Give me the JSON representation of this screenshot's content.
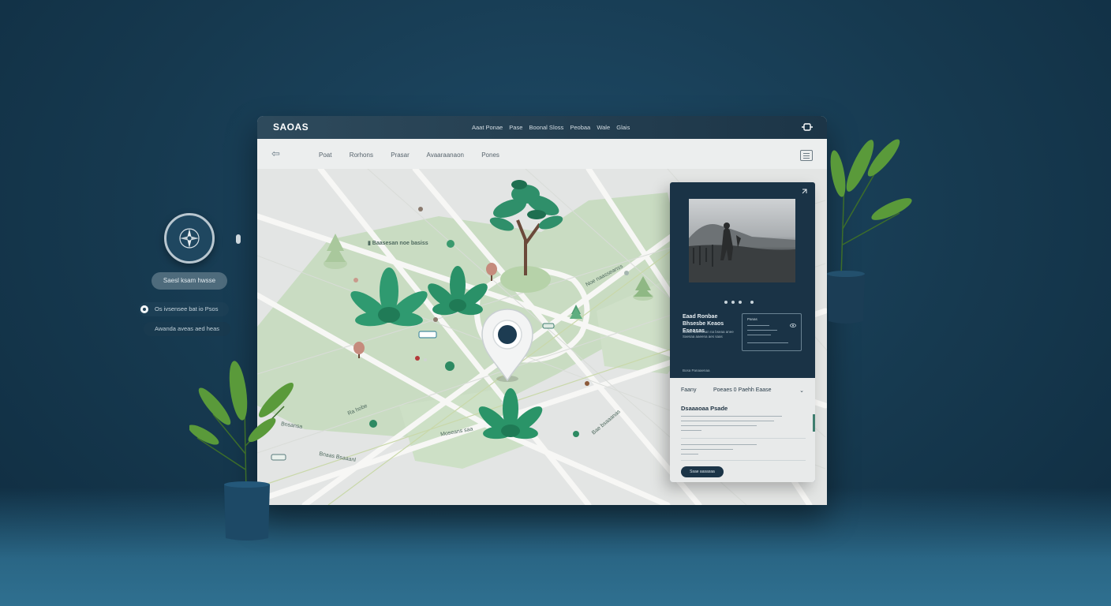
{
  "left_panel": {
    "compass_icon": "compass-icon",
    "primary_pill": "Saesl ksam hwsse",
    "radio_option": "Os ivsensee bat io Psos",
    "secondary_pill": "Awanda aveas aed heas"
  },
  "window": {
    "brand": "SAOAS",
    "top_menu": [
      "Aaat Ponae",
      "Pase",
      "Boonal Sloss",
      "Peobaa",
      "Wale",
      "Glais"
    ],
    "nav_tabs": [
      "Poat",
      "Rorhons",
      "Prasar",
      "Avaaraanaon",
      "Pones"
    ],
    "icons": {
      "window_toggle": "window-toggle-icon",
      "back": "back-arrow-icon",
      "menu": "menu-list-icon"
    }
  },
  "map": {
    "labels": {
      "area": "Baasesan noe basiss",
      "road_a": "Ra hobe",
      "road_b": "Bnsansa",
      "road_c": "Bnaas Bsaaanl",
      "road_d": "Noe naasseanss",
      "road_e": "Bae bsaaanas",
      "road_f": "Moseans saa"
    },
    "accent": "#2e8b6a",
    "park_green": "#c8dbc0"
  },
  "detail_card": {
    "title": "Eaad Ronbae Bhsesbe Keaos Eseasas",
    "subtitle": "Bsaas aaeenaan na bseaa anee Saesaa aaeena aes saas",
    "info_box_title": "Panas",
    "section_label": "Bosa Panaaenaa",
    "row_left": "Faany",
    "row_right": "Poeaes 0 Paehh Eaase",
    "heading": "Dsaaaoaa Psade",
    "button": "Ssae aasasaa"
  }
}
